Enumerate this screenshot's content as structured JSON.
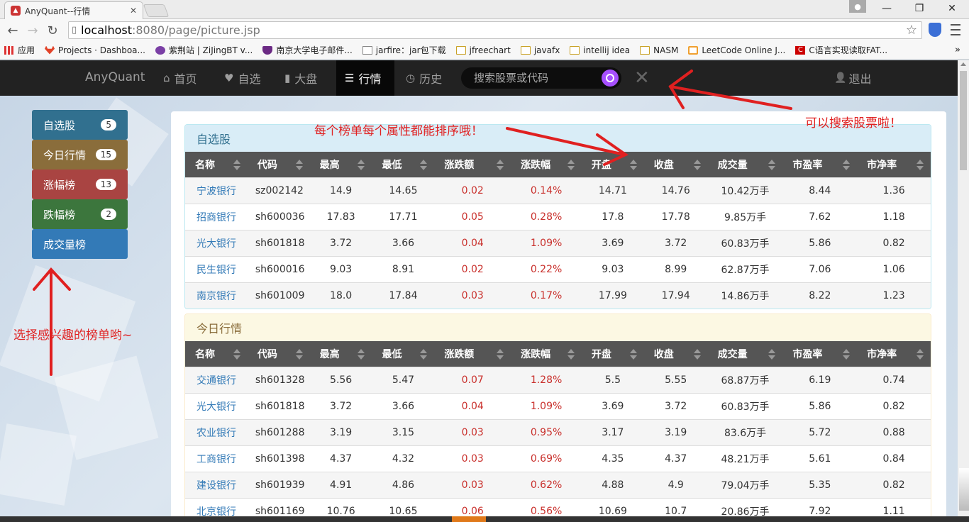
{
  "browser": {
    "tab_title": "AnyQuant--行情",
    "tab_close": "✕",
    "window_buttons": [
      "—",
      "❐",
      "✕"
    ],
    "url_host": "localhost",
    "url_rest": ":8080/page/picture.jsp",
    "bookmarks": [
      {
        "label": "应用",
        "icon": "apps-icon"
      },
      {
        "label": "Projects · Dashboa...",
        "icon": "gitlab-icon"
      },
      {
        "label": "紫荆站 | ZiJingBT v...",
        "icon": "zijing-icon"
      },
      {
        "label": "南京大学电子邮件...",
        "icon": "nju-icon"
      },
      {
        "label": "jarfire：jar包下载",
        "icon": "page-icon"
      },
      {
        "label": "jfreechart",
        "icon": "folder-icon"
      },
      {
        "label": "javafx",
        "icon": "folder-icon"
      },
      {
        "label": "intellij idea",
        "icon": "folder-icon"
      },
      {
        "label": "NASM",
        "icon": "folder-icon"
      },
      {
        "label": "LeetCode Online J...",
        "icon": "leetcode-icon"
      },
      {
        "label": "C语言实现读取FAT...",
        "icon": "c-icon"
      }
    ],
    "bookmarks_more": "»"
  },
  "nav": {
    "brand": "AnyQuant",
    "items": [
      {
        "label": "首页",
        "icon": "⌂",
        "icon_name": "home-icon"
      },
      {
        "label": "自选",
        "icon": "♥",
        "icon_name": "heart-icon"
      },
      {
        "label": "大盘",
        "icon": "▮",
        "icon_name": "bar-chart-icon"
      },
      {
        "label": "行情",
        "icon": "☰",
        "icon_name": "list-icon"
      },
      {
        "label": "历史",
        "icon": "◷",
        "icon_name": "clock-icon"
      }
    ],
    "search_placeholder": "搜索股票或代码",
    "clear": "✕",
    "logout": "退出",
    "logout_icon": "👤"
  },
  "sidebar": [
    {
      "label": "自选股",
      "badge": "5",
      "color": "#31708f"
    },
    {
      "label": "今日行情",
      "badge": "15",
      "color": "#8a6d3b"
    },
    {
      "label": "涨幅榜",
      "badge": "13",
      "color": "#a94442"
    },
    {
      "label": "跌幅榜",
      "badge": "2",
      "color": "#3c763d"
    },
    {
      "label": "成交量榜",
      "badge": "",
      "color": "#337ab7"
    }
  ],
  "columns": [
    "名称",
    "代码",
    "最高",
    "最低",
    "涨跌额",
    "涨跌幅",
    "开盘",
    "收盘",
    "成交量",
    "市盈率",
    "市净率"
  ],
  "sections": [
    {
      "title": "自选股",
      "head_bg": "#d9edf7",
      "head_color": "#31708f",
      "border": "#bce8f1",
      "rows": [
        [
          "宁波银行",
          "sz002142",
          "14.9",
          "14.65",
          "0.02",
          "0.14%",
          "14.71",
          "14.76",
          "10.42万手",
          "8.44",
          "1.36"
        ],
        [
          "招商银行",
          "sh600036",
          "17.83",
          "17.71",
          "0.05",
          "0.28%",
          "17.8",
          "17.78",
          "9.85万手",
          "7.62",
          "1.18"
        ],
        [
          "光大银行",
          "sh601818",
          "3.72",
          "3.66",
          "0.04",
          "1.09%",
          "3.69",
          "3.72",
          "60.83万手",
          "5.86",
          "0.82"
        ],
        [
          "民生银行",
          "sh600016",
          "9.03",
          "8.91",
          "0.02",
          "0.22%",
          "9.03",
          "8.99",
          "62.87万手",
          "7.06",
          "1.06"
        ],
        [
          "南京银行",
          "sh601009",
          "18.0",
          "17.84",
          "0.03",
          "0.17%",
          "17.99",
          "17.94",
          "14.86万手",
          "8.22",
          "1.23"
        ]
      ]
    },
    {
      "title": "今日行情",
      "head_bg": "#fcf8e3",
      "head_color": "#8a6d3b",
      "border": "#faebcc",
      "rows": [
        [
          "交通银行",
          "sh601328",
          "5.56",
          "5.47",
          "0.07",
          "1.28%",
          "5.5",
          "5.55",
          "68.87万手",
          "6.19",
          "0.74"
        ],
        [
          "光大银行",
          "sh601818",
          "3.72",
          "3.66",
          "0.04",
          "1.09%",
          "3.69",
          "3.72",
          "60.83万手",
          "5.86",
          "0.82"
        ],
        [
          "农业银行",
          "sh601288",
          "3.19",
          "3.15",
          "0.03",
          "0.95%",
          "3.17",
          "3.19",
          "83.6万手",
          "5.72",
          "0.88"
        ],
        [
          "工商银行",
          "sh601398",
          "4.37",
          "4.32",
          "0.03",
          "0.69%",
          "4.35",
          "4.37",
          "48.21万手",
          "5.61",
          "0.84"
        ],
        [
          "建设银行",
          "sh601939",
          "4.91",
          "4.86",
          "0.03",
          "0.62%",
          "4.88",
          "4.9",
          "79.04万手",
          "5.35",
          "0.82"
        ],
        [
          "北京银行",
          "sh601169",
          "10.76",
          "10.65",
          "0.06",
          "0.56%",
          "10.69",
          "10.7",
          "20.86万手",
          "7.92",
          "1.11"
        ]
      ]
    }
  ],
  "annotations": {
    "sort_note": "每个榜单每个属性都能排序哦！",
    "search_note": "可以搜索股票啦！",
    "sidebar_note": "选择感兴趣的榜单哟~",
    "color": "#e02020"
  }
}
